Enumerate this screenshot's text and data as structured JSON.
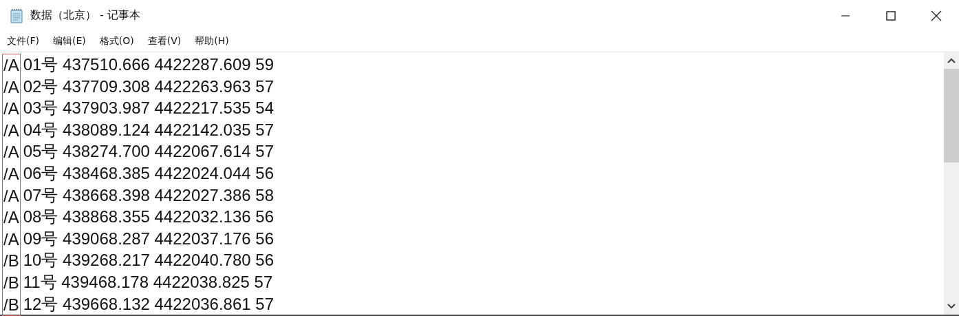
{
  "window": {
    "title": "数据（北京） - 记事本"
  },
  "menu": [
    "文件(F)",
    "编辑(E)",
    "格式(O)",
    "查看(V)",
    "帮助(H)"
  ],
  "editor": {
    "prefix_highlighted": true,
    "lines": [
      {
        "prefix": "/A",
        "text": "01号 437510.666 4422287.609 59"
      },
      {
        "prefix": "/A",
        "text": "02号 437709.308 4422263.963 57"
      },
      {
        "prefix": "/A",
        "text": "03号 437903.987 4422217.535 54"
      },
      {
        "prefix": "/A",
        "text": "04号 438089.124 4422142.035 57"
      },
      {
        "prefix": "/A",
        "text": "05号 438274.700 4422067.614 57"
      },
      {
        "prefix": "/A",
        "text": "06号 438468.385 4422024.044 56"
      },
      {
        "prefix": "/A",
        "text": "07号 438668.398 4422027.386 58"
      },
      {
        "prefix": "/A",
        "text": "08号 438868.355 4422032.136 56"
      },
      {
        "prefix": "/A",
        "text": "09号 439068.287 4422037.176 56"
      },
      {
        "prefix": "/B",
        "text": "10号 439268.217 4422040.780 56"
      },
      {
        "prefix": "/B",
        "text": "11号 439468.178 4422038.825 57"
      },
      {
        "prefix": "/B",
        "text": "12号 439668.132 4422036.861 57"
      }
    ]
  }
}
